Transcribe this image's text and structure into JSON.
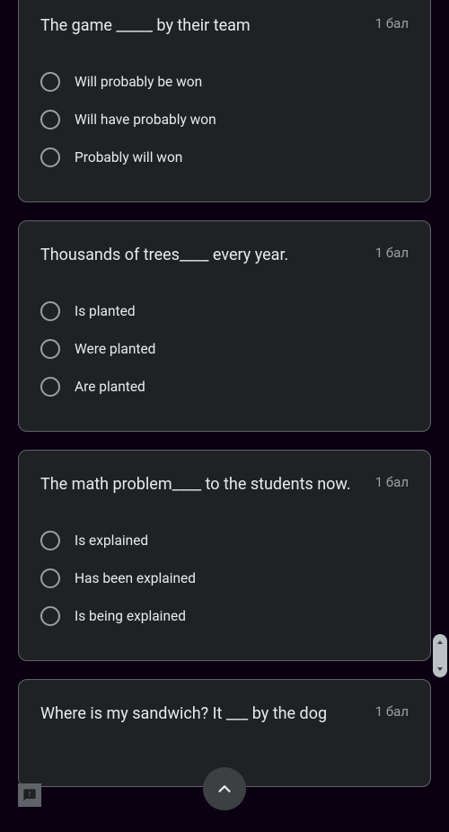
{
  "points_label": "1 бал",
  "questions": [
    {
      "text": "The game _____ by their team",
      "options": [
        "Will probably be won",
        "Will have probably won",
        "Probably will won"
      ]
    },
    {
      "text": "Thousands of trees____ every year.",
      "options": [
        "Is planted",
        "Were planted",
        "Are planted"
      ]
    },
    {
      "text": "The math problem____ to the students now.",
      "options": [
        "Is explained",
        "Has been explained",
        "Is being explained"
      ]
    },
    {
      "text": "Where is my sandwich? It ___ by the dog",
      "options": []
    }
  ],
  "icons": {
    "scroll_top": "chevron-up",
    "feedback": "feedback"
  }
}
